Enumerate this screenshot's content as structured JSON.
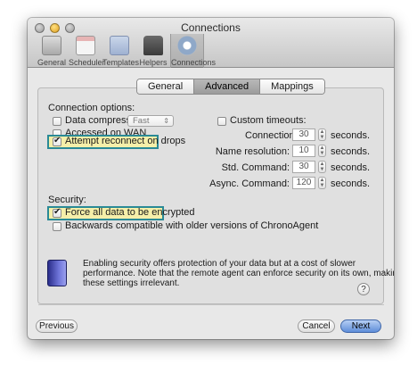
{
  "window": {
    "title": "Connections"
  },
  "toolbar": {
    "items": [
      {
        "label": "General",
        "icon": "general-icon"
      },
      {
        "label": "Scheduler",
        "icon": "calendar-icon"
      },
      {
        "label": "Templates",
        "icon": "templates-icon"
      },
      {
        "label": "Helpers",
        "icon": "helpers-icon"
      },
      {
        "label": "Connections",
        "icon": "connections-icon",
        "active": true
      }
    ]
  },
  "tabs": [
    {
      "label": "General",
      "active": false
    },
    {
      "label": "Advanced",
      "active": true
    },
    {
      "label": "Mappings",
      "active": false
    }
  ],
  "connection_options": {
    "heading": "Connection options:",
    "data_compression": {
      "label": "Data compression:",
      "checked": false,
      "value": "Fast"
    },
    "accessed_on_wan": {
      "label": "Accessed on WAN",
      "checked": false
    },
    "attempt_reconnect": {
      "label": "Attempt reconnect on drops",
      "checked": true
    }
  },
  "timeouts": {
    "label": "Custom timeouts:",
    "checked": false,
    "unit": "seconds.",
    "fields": [
      {
        "label": "Connection:",
        "value": "30"
      },
      {
        "label": "Name resolution:",
        "value": "10"
      },
      {
        "label": "Std. Command:",
        "value": "30"
      },
      {
        "label": "Async. Command:",
        "value": "120"
      }
    ]
  },
  "security": {
    "heading": "Security:",
    "force_encrypt": {
      "label": "Force all data to be encrypted",
      "checked": true
    },
    "backwards_compat": {
      "label": "Backwards compatible with older versions of ChronoAgent",
      "checked": false
    },
    "info_line1": "Enabling security offers protection of your data but at a cost of slower",
    "info_line2": "performance. Note that the remote agent can enforce security on its own, making",
    "info_line3": "these settings irrelevant."
  },
  "help": {
    "label": "?"
  },
  "buttons": {
    "previous": "Previous",
    "cancel": "Cancel",
    "next": "Next"
  },
  "colors": {
    "highlight_border": "#2a8a96",
    "highlight_fill": "#f5efa9",
    "primary": "#5e8ed9"
  }
}
